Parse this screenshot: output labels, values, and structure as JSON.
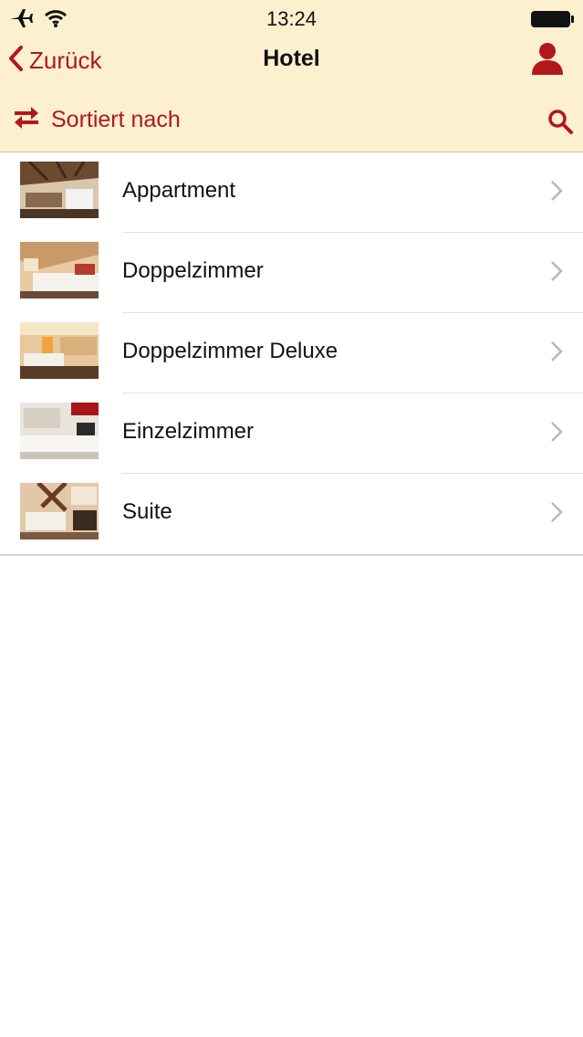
{
  "status_bar": {
    "time": "13:24",
    "icons": [
      "airplane-icon",
      "wifi-icon",
      "battery-icon"
    ]
  },
  "nav": {
    "back_label": "Zurück",
    "title": "Hotel",
    "profile_icon": "user-icon"
  },
  "toolbar": {
    "sort_label": "Sortiert nach",
    "sort_icon": "swap-arrows-icon",
    "search_icon": "search-icon"
  },
  "rooms": [
    {
      "name": "Appartment"
    },
    {
      "name": "Doppelzimmer"
    },
    {
      "name": "Doppelzimmer Deluxe"
    },
    {
      "name": "Einzelzimmer"
    },
    {
      "name": "Suite"
    }
  ],
  "colors": {
    "accent": "#b2171c",
    "header_bg": "#fdf0cf"
  }
}
